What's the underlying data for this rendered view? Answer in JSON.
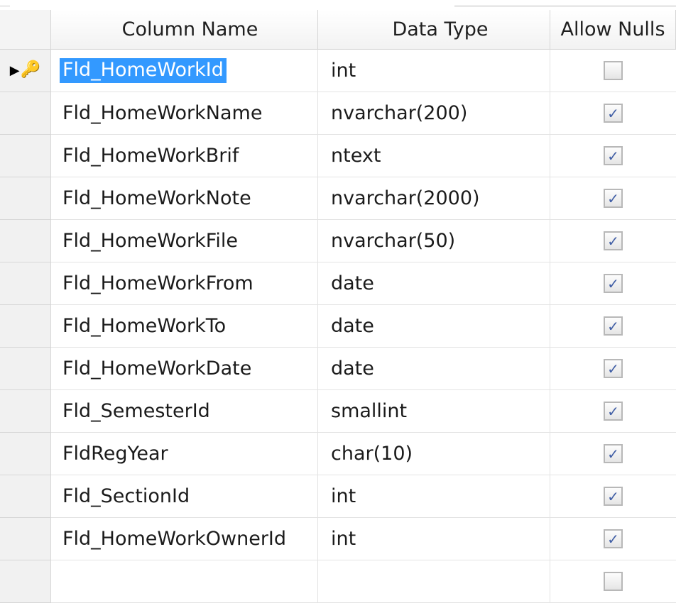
{
  "header": {
    "column_name": "Column Name",
    "data_type": "Data Type",
    "allow_nulls": "Allow Nulls"
  },
  "icons": {
    "row_indicator_arrow": "▶",
    "primary_key": "🔑"
  },
  "rows": [
    {
      "name": "Fld_HomeWorkId",
      "type": "int",
      "allow_nulls": false,
      "selected": true,
      "primary_key": true
    },
    {
      "name": "Fld_HomeWorkName",
      "type": "nvarchar(200)",
      "allow_nulls": true
    },
    {
      "name": "Fld_HomeWorkBrif",
      "type": "ntext",
      "allow_nulls": true
    },
    {
      "name": "Fld_HomeWorkNote",
      "type": "nvarchar(2000)",
      "allow_nulls": true
    },
    {
      "name": "Fld_HomeWorkFile",
      "type": "nvarchar(50)",
      "allow_nulls": true
    },
    {
      "name": "Fld_HomeWorkFrom",
      "type": "date",
      "allow_nulls": true
    },
    {
      "name": "Fld_HomeWorkTo",
      "type": "date",
      "allow_nulls": true
    },
    {
      "name": "Fld_HomeWorkDate",
      "type": "date",
      "allow_nulls": true
    },
    {
      "name": "Fld_SemesterId",
      "type": "smallint",
      "allow_nulls": true
    },
    {
      "name": "FldRegYear",
      "type": "char(10)",
      "allow_nulls": true
    },
    {
      "name": "Fld_SectionId",
      "type": "int",
      "allow_nulls": true
    },
    {
      "name": "Fld_HomeWorkOwnerId",
      "type": "int",
      "allow_nulls": true
    },
    {
      "name": "",
      "type": "",
      "allow_nulls": false
    }
  ],
  "colors": {
    "selection": "#3399ff",
    "checkbox_check": "#405ea5",
    "key": "#d2a100"
  }
}
